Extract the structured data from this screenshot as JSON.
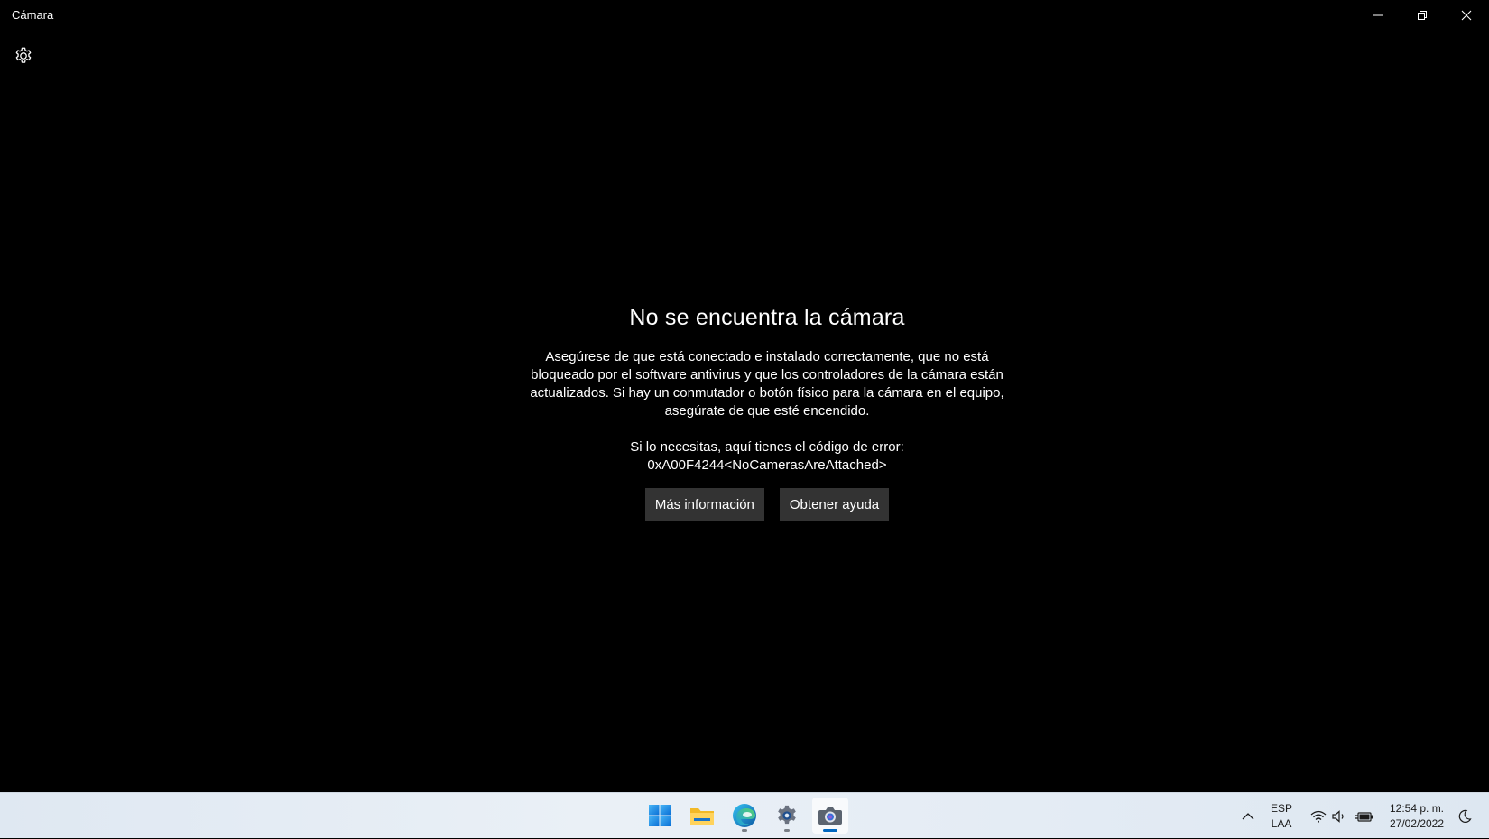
{
  "window": {
    "title": "Cámara"
  },
  "error": {
    "title": "No se encuentra la cámara",
    "message": "Asegúrese de que está conectado e instalado correctamente, que no está bloqueado por el software antivirus y que los controladores de la cámara están actualizados. Si hay un conmutador o botón físico para la cámara en el equipo, asegúrate de que esté encendido.",
    "code_label": "Si lo necesitas, aquí tienes el código de error:",
    "code": "0xA00F4244<NoCamerasAreAttached>",
    "buttons": {
      "more_info": "Más información",
      "get_help": "Obtener ayuda"
    }
  },
  "taskbar": {
    "apps": [
      {
        "name": "start",
        "icon": "windows-logo-icon"
      },
      {
        "name": "file-explorer",
        "icon": "folder-icon"
      },
      {
        "name": "edge",
        "icon": "edge-icon"
      },
      {
        "name": "settings",
        "icon": "gear-icon"
      },
      {
        "name": "camera",
        "icon": "camera-icon"
      }
    ],
    "tray": {
      "language_primary": "ESP",
      "language_secondary": "LAA",
      "time": "12:54 p. m.",
      "date": "27/02/2022"
    }
  },
  "colors": {
    "background": "#000000",
    "button_bg": "#333333",
    "taskbar_accent": "#0067c0"
  }
}
